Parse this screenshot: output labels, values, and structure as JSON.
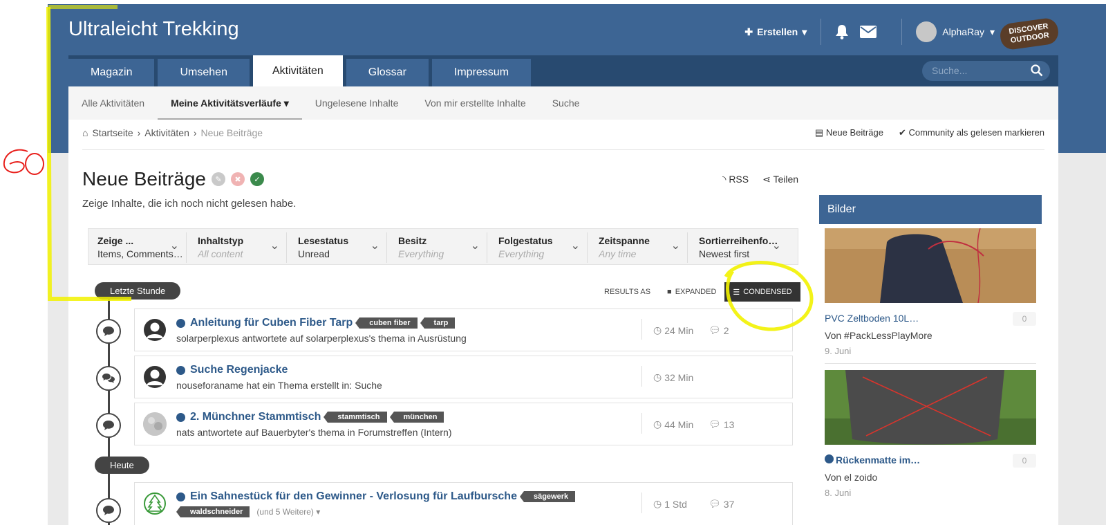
{
  "header": {
    "brand": "Ultraleicht Trekking",
    "create_label": "Erstellen",
    "username": "AlphaRay",
    "logo_text_1": "DISCOVER",
    "logo_text_2": "OUTDOOR"
  },
  "nav": {
    "tabs": [
      {
        "label": "Magazin",
        "active": false
      },
      {
        "label": "Umsehen",
        "active": false
      },
      {
        "label": "Aktivitäten",
        "active": true
      },
      {
        "label": "Glossar",
        "active": false
      },
      {
        "label": "Impressum",
        "active": false
      }
    ],
    "search_placeholder": "Suche..."
  },
  "subnav": {
    "items": [
      {
        "label": "Alle Aktivitäten"
      },
      {
        "label": "Meine Aktivitätsverläufe"
      },
      {
        "label": "Ungelesene Inhalte"
      },
      {
        "label": "Von mir erstellte Inhalte"
      },
      {
        "label": "Suche"
      }
    ]
  },
  "breadcrumb": {
    "home": "Startseite",
    "activities": "Aktivitäten",
    "current": "Neue Beiträge",
    "action_new": "Neue Beiträge",
    "action_mark": "Community als gelesen markieren"
  },
  "page": {
    "title": "Neue Beiträge",
    "subtitle": "Zeige Inhalte, die ich noch nicht gelesen habe.",
    "rss": "RSS",
    "share": "Teilen"
  },
  "filters": [
    {
      "label": "Zeige ...",
      "value": "Items, Comments…",
      "muted": false
    },
    {
      "label": "Inhaltstyp",
      "value": "All content",
      "muted": true
    },
    {
      "label": "Lesestatus",
      "value": "Unread",
      "muted": false
    },
    {
      "label": "Besitz",
      "value": "Everything",
      "muted": true
    },
    {
      "label": "Folgestatus",
      "value": "Everything",
      "muted": true
    },
    {
      "label": "Zeitspanne",
      "value": "Any time",
      "muted": true
    },
    {
      "label": "Sortierreihenfo…",
      "value": "Newest first",
      "muted": false
    }
  ],
  "results": {
    "label": "RESULTS AS",
    "expanded": "EXPANDED",
    "condensed": "CONDENSED"
  },
  "groups": {
    "last_hour": "Letzte Stunde",
    "today": "Heute"
  },
  "items": [
    {
      "title": "Anleitung für Cuben Fiber Tarp",
      "tags": [
        "cuben fiber",
        "tarp"
      ],
      "sub": "solarperplexus antwortete auf solarperplexus's thema in Ausrüstung",
      "time": "24 Min",
      "comments": "2"
    },
    {
      "title": "Suche Regenjacke",
      "tags": [],
      "sub": "nouseforaname hat ein Thema erstellt in: Suche",
      "time": "32 Min",
      "comments": ""
    },
    {
      "title": "2. Münchner Stammtisch",
      "tags": [
        "stammtisch",
        "münchen"
      ],
      "sub": "nats antwortete auf Bauerbyter's thema in Forumstreffen (Intern)",
      "time": "44 Min",
      "comments": "13"
    },
    {
      "title": "Ein Sahnestück für den Gewinner - Verlosung für Laufbursche",
      "tags": [
        "sägewerk",
        "waldschneider"
      ],
      "more": "(und 5 Weitere)",
      "time": "1 Std",
      "comments": "37"
    }
  ],
  "sidebar": {
    "heading": "Bilder",
    "cards": [
      {
        "title": "PVC Zeltboden 10L…",
        "by": "Von #PackLessPlayMore",
        "date": "9. Juni",
        "count": "0"
      },
      {
        "title": "Rückenmatte im…",
        "by": "Von el zoido",
        "date": "8. Juni",
        "count": "0"
      }
    ]
  },
  "annotations": {
    "handwritten": "60 %",
    "colors": {
      "highlight": "#f2f200",
      "ink": "#e8201c"
    }
  }
}
